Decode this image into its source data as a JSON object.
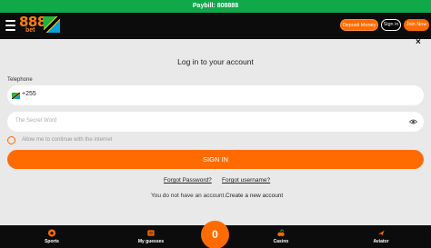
{
  "paybill": {
    "text": "Paybill: 808888"
  },
  "header": {
    "logo_number": "888",
    "logo_sub": "bet",
    "deposit_label": "Deposit Money",
    "signin_label": "Sign in",
    "join_label": "Join Now"
  },
  "login": {
    "close_label": "×",
    "title": "Log in to your account",
    "telephone_label": "Telephone",
    "country_code": "+255",
    "password_placeholder": "The Secret Word",
    "remember_text": "Allow me to continue with the internet",
    "submit_label": "SIGN IN",
    "forgot_password": "Forgot Password?",
    "forgot_username": "Forgot username?",
    "no_account_text": "You do not have an account.",
    "create_account": "Create a new account"
  },
  "bottom_nav": {
    "sports": "Sports",
    "my_guesses": "My guesses",
    "betslip_count": "0",
    "casino": "Casino",
    "aviator": "Aviator"
  },
  "colors": {
    "accent": "#ff6b00",
    "paybill_green": "#11a84a",
    "topbar": "#0c0c0c",
    "background": "#e9e9e9"
  },
  "icons": [
    "menu-icon",
    "tanzania-flag-icon",
    "close-icon",
    "eye-icon",
    "sports-icon",
    "my-guesses-icon",
    "casino-icon",
    "aviator-icon"
  ]
}
